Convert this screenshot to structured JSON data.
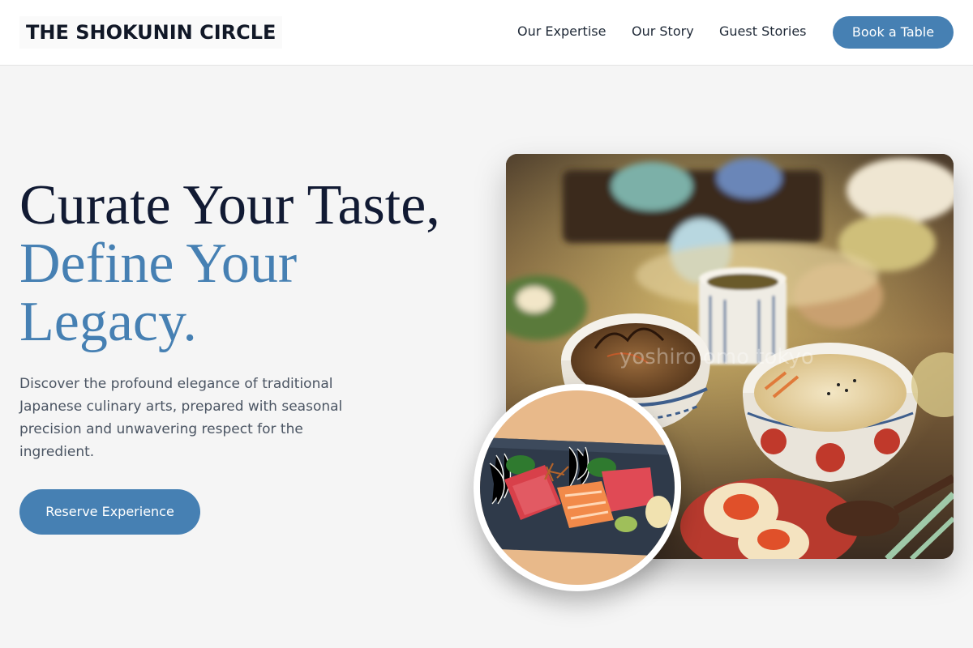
{
  "brand": {
    "name": "THE SHOKUNIN CIRCLE"
  },
  "nav": {
    "items": [
      {
        "label": "Our Expertise"
      },
      {
        "label": "Our Story"
      },
      {
        "label": "Guest Stories"
      }
    ],
    "cta_label": "Book a Table"
  },
  "hero": {
    "headline_line1": "Curate Your Taste,",
    "headline_line2": "Define Your",
    "headline_line3": "Legacy.",
    "description": "Discover the profound elegance of traditional Japanese culinary arts, prepared with seasonal precision and unwavering respect for the ingredient.",
    "cta_label": "Reserve Experience",
    "photo_watermark": "yoshiro omo tokyo"
  },
  "colors": {
    "accent": "#4680b3",
    "heading_dark": "#111a33",
    "background": "#f5f5f5"
  },
  "images": {
    "main_photo": "japanese-set-meal-photo",
    "inset_photo": "sashimi-platter-photo"
  }
}
